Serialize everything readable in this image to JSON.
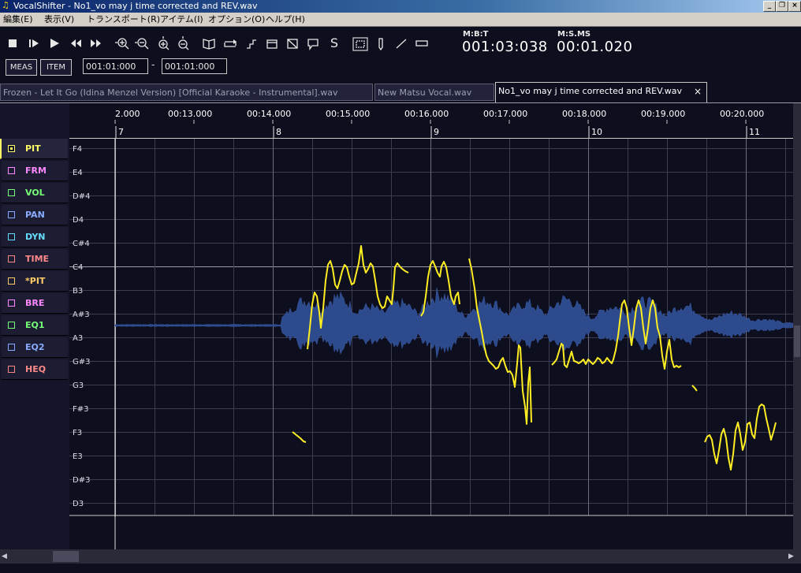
{
  "window": {
    "title": "VocalShifter - No1_vo may j time corrected and REV.wav",
    "app_icon": "music-note-icon",
    "controls": [
      "minimize-icon",
      "restore-icon",
      "close-icon"
    ]
  },
  "menu": [
    "編集(E)",
    "表示(V)",
    "トランスポート(R)",
    "アイテム(I)",
    "オプション(O)",
    "ヘルプ(H)"
  ],
  "toolbar": {
    "icons": [
      "stop-icon",
      "play-from-start-icon",
      "play-icon",
      "rewind-icon",
      "fast-forward-icon",
      "zoom-in-horizontal-icon",
      "zoom-out-horizontal-icon",
      "zoom-in-vertical-icon",
      "zoom-out-vertical-icon",
      "book-icon",
      "loop-icon",
      "step-icon",
      "window-icon",
      "grid-icon",
      "comment-icon",
      "solo-icon",
      "select-icon",
      "pencil-icon",
      "line-icon",
      "eraser-icon"
    ],
    "solo_label": "S",
    "meas_label": "MEAS",
    "item_label": "ITEM",
    "range_start": "001:01:000",
    "range_separator": "-",
    "range_end": "001:01:000",
    "mbt_label": "M:B:T",
    "mbt_value": "001:03:038",
    "msms_label": "M:S.MS",
    "msms_value": "00:01.020"
  },
  "tabs": [
    {
      "label": "Frozen - Let It Go (Idina Menzel Version) [Official Karaoke - Instrumental].wav",
      "active": false
    },
    {
      "label": "New Matsu Vocal.wav",
      "active": false
    },
    {
      "label": "No1_vo may j time corrected and REV.wav",
      "active": true
    }
  ],
  "tab_close": "×",
  "params": [
    {
      "label": "PIT",
      "color": "#ffff66",
      "active": true
    },
    {
      "label": "FRM",
      "color": "#ff88ff",
      "active": false
    },
    {
      "label": "VOL",
      "color": "#77ff77",
      "active": false
    },
    {
      "label": "PAN",
      "color": "#88aaff",
      "active": false
    },
    {
      "label": "DYN",
      "color": "#66ddff",
      "active": false
    },
    {
      "label": "TIME",
      "color": "#ff8888",
      "active": false
    },
    {
      "label": "*PIT",
      "color": "#ffcc66",
      "active": false
    },
    {
      "label": "BRE",
      "color": "#ff88ff",
      "active": false
    },
    {
      "label": "EQ1",
      "color": "#77ff77",
      "active": false
    },
    {
      "label": "EQ2",
      "color": "#88aaff",
      "active": false
    },
    {
      "label": "HEQ",
      "color": "#ff8888",
      "active": false
    }
  ],
  "ruler": {
    "times": [
      "2.000",
      "00:13.000",
      "00:14.000",
      "00:15.000",
      "00:16.000",
      "00:17.000",
      "00:18.000",
      "00:19.000",
      "00:20.000"
    ],
    "measures": [
      "7",
      "8",
      "9",
      "10",
      "11"
    ]
  },
  "notes": [
    "F4",
    "E4",
    "D#4",
    "D4",
    "C#4",
    "C4",
    "B3",
    "A#3",
    "A3",
    "G#3",
    "G3",
    "F#3",
    "F3",
    "E3",
    "D#3",
    "D3"
  ],
  "colors": {
    "pitch_curve": "#ffee22",
    "waveform": "#2c4a8c",
    "background": "#0d0e1e",
    "grid": "#3c3d52"
  }
}
